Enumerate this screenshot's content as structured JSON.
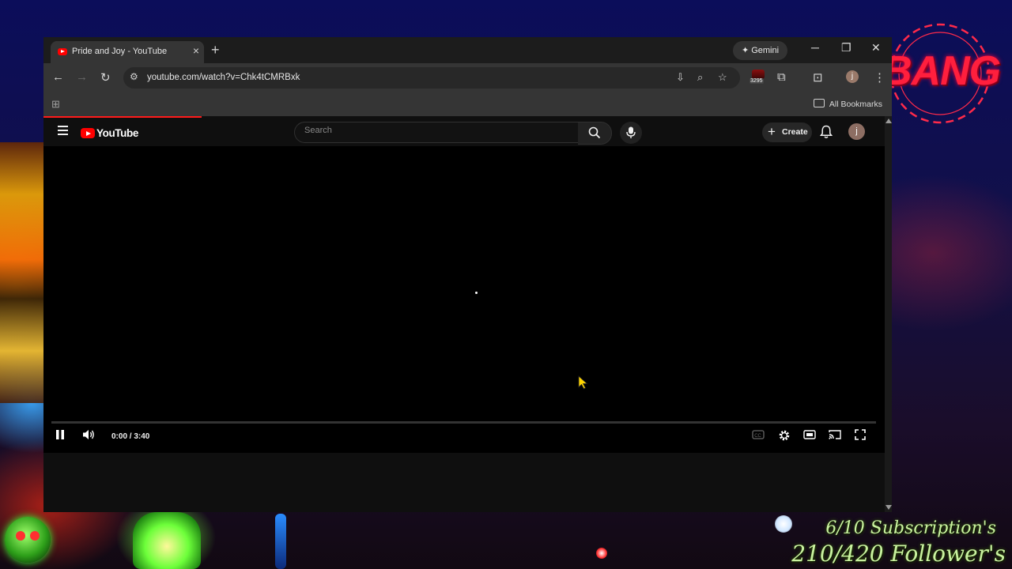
{
  "browser": {
    "tab_title": "Pride and Joy - YouTube",
    "tab_close": "×",
    "new_tab": "+",
    "gemini_label": "Gemini",
    "url": "youtube.com/watch?v=Chk4tCMRBxk",
    "extension_badge": "3295",
    "profile_initial": "j",
    "bookmarks_label": "All Bookmarks"
  },
  "youtube": {
    "logo_text": "YouTube",
    "search_placeholder": "Search",
    "create_label": "Create",
    "avatar_initial": "j",
    "player": {
      "time": "0:00 / 3:40",
      "progress": 0
    }
  },
  "overlay": {
    "logo_text": "BANG",
    "subscriptions": "6/10 Subscription's",
    "followers": "210/420 Follower's"
  },
  "colors": {
    "accent": "#ff0000",
    "browser_chrome": "#353535",
    "page_bg": "#0f0f0f"
  }
}
